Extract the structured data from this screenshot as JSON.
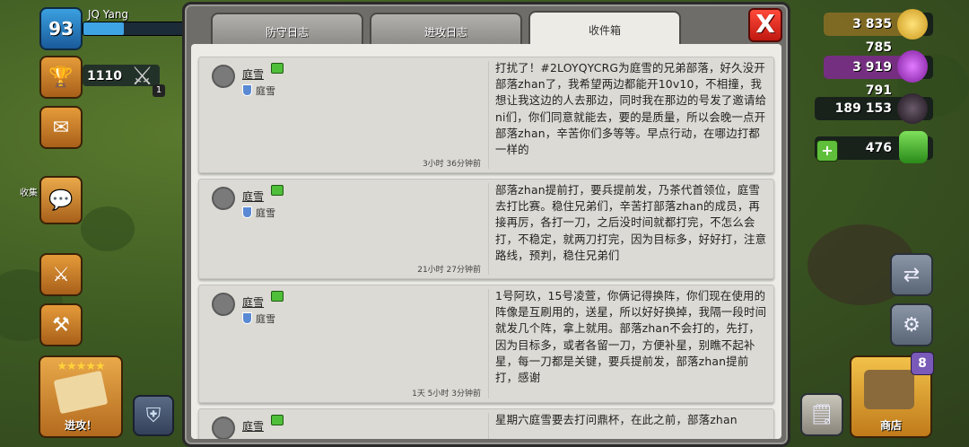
{
  "player": {
    "level": "93",
    "name": "JQ Yang",
    "trophies": "1110",
    "attack_count": "1"
  },
  "left_hud": {
    "side_label": "收集",
    "attack_label": "进攻！",
    "stars": "★★★★★"
  },
  "resources": {
    "gold": "3 835 785",
    "elixir": "3 919 791",
    "dark_elixir": "189 153",
    "gems": "476"
  },
  "shop": {
    "label": "商店",
    "badge": "8"
  },
  "tabs": [
    {
      "label": "防守日志",
      "active": false
    },
    {
      "label": "进攻日志",
      "active": false
    },
    {
      "label": "收件箱",
      "active": true
    }
  ],
  "close_label": "X",
  "messages": [
    {
      "sender": "庭雪",
      "clan": "庭雪",
      "time": "3小时 36分钟前",
      "text": "打扰了！#2LOYQYCRG为庭雪的兄弟部落，好久没开部落zhan了，我希望两边都能开10v10，不相撞，我想让我这边的人去那边，同时我在那边的号发了邀请给ni们，你们同意就能去，要的是质量，所以会晚一点开部落zhan，辛苦你们多等等。早点行动，在哪边打都一样的"
    },
    {
      "sender": "庭雪",
      "clan": "庭雪",
      "time": "21小时 27分钟前",
      "text": "部落zhan提前打，要兵提前发，乃茶代首领位，庭雪去打比赛。稳住兄弟们，辛苦打部落zhan的成员，再接再厉，各打一刀，之后没时间就都打完，不怎么会打，不稳定，就两刀打完，因为目标多，好好打，注意路线，预判，稳住兄弟们"
    },
    {
      "sender": "庭雪",
      "clan": "庭雪",
      "time": "1天 5小时 3分钟前",
      "text": "1号阿玖，15号凌萱，你俩记得换阵，你们现在使用的阵像是互刷用的，送星，所以好好换掉，我隔一段时间就发几个阵，拿上就用。部落zhan不会打的，先打，因为目标多，或者各留一刀，方便补星，别瞧不起补星，每一刀都是关键，要兵提前发，部落zhan提前打，感谢"
    },
    {
      "sender": "庭雪",
      "clan": "",
      "time": "",
      "text": "星期六庭雪要去打问鼎杯，在此之前，部落zhan"
    }
  ]
}
